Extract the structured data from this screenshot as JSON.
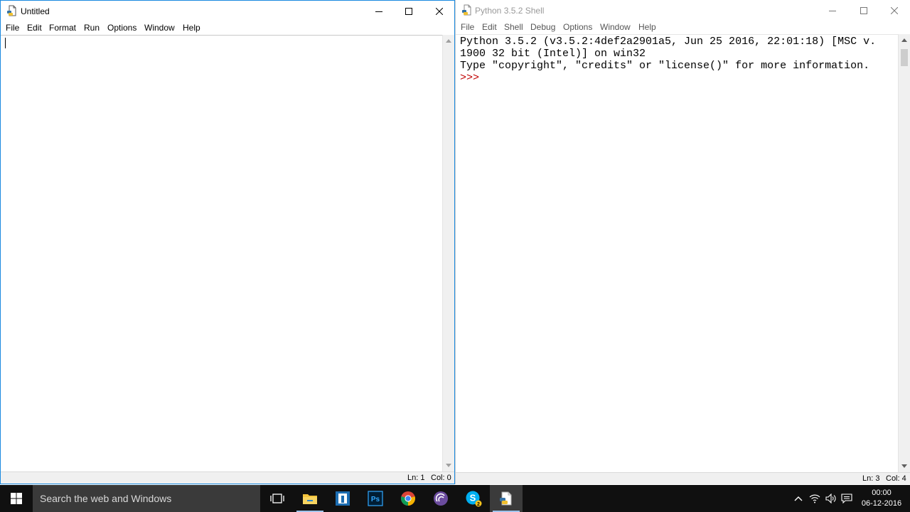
{
  "left_window": {
    "title": "Untitled",
    "menu": [
      "File",
      "Edit",
      "Format",
      "Run",
      "Options",
      "Window",
      "Help"
    ],
    "status": {
      "line": "Ln: 1",
      "col": "Col: 0"
    }
  },
  "right_window": {
    "title": "Python 3.5.2 Shell",
    "menu": [
      "File",
      "Edit",
      "Shell",
      "Debug",
      "Options",
      "Window",
      "Help"
    ],
    "shell_lines": [
      "Python 3.5.2 (v3.5.2:4def2a2901a5, Jun 25 2016, 22:01:18) [MSC v.",
      "1900 32 bit (Intel)] on win32",
      "Type \"copyright\", \"credits\" or \"license()\" for more information."
    ],
    "prompt": ">>>",
    "status": {
      "line": "Ln: 3",
      "col": "Col: 4"
    }
  },
  "taskbar": {
    "search_placeholder": "Search the web and Windows",
    "pinned_icons": [
      "task-view-icon",
      "file-explorer-icon",
      "app-icon",
      "photoshop-icon",
      "chrome-icon",
      "torrent-client-icon",
      "skype-icon",
      "idle-python-icon"
    ],
    "tray_icons": [
      "chevron-up-icon",
      "wifi-icon",
      "volume-icon",
      "notifications-icon"
    ],
    "photoshop_label": "Ps",
    "skype_badge": "2",
    "clock_time": "00:00",
    "clock_date": "06-12-2016"
  },
  "colors": {
    "active_border": "#1a8ae0",
    "prompt": "#c00000",
    "taskbar": "#101010",
    "search_box": "#3a3a3a"
  }
}
